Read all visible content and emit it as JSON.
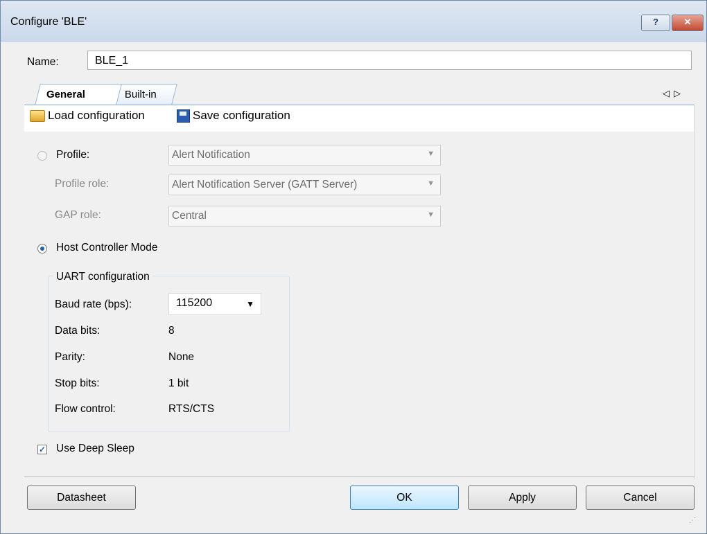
{
  "window": {
    "title": "Configure 'BLE'",
    "help_label": "?",
    "close_label": "✕"
  },
  "name_field": {
    "label": "Name:",
    "value": "BLE_1"
  },
  "tabs": [
    {
      "label": "General"
    },
    {
      "label": "Built-in"
    }
  ],
  "tab_scroll": {
    "left": "◁",
    "right": "▷"
  },
  "toolbar": {
    "load_label": "Load configuration",
    "save_label": "Save configuration",
    "load_icon": "folder-open-icon",
    "save_icon": "floppy-disk-icon"
  },
  "profile": {
    "radio_label": "Profile:",
    "profile_value": "Alert Notification",
    "role_label": "Profile role:",
    "role_value": "Alert Notification Server (GATT Server)",
    "gap_label": "GAP role:",
    "gap_value": "Central"
  },
  "host": {
    "radio_label": "Host Controller Mode"
  },
  "uart": {
    "title": "UART configuration",
    "rows": [
      {
        "label": "Baud rate (bps):",
        "value": "115200"
      },
      {
        "label": "Data bits:",
        "value": "8"
      },
      {
        "label": "Parity:",
        "value": "None"
      },
      {
        "label": "Stop bits:",
        "value": "1 bit"
      },
      {
        "label": "Flow control:",
        "value": "RTS/CTS"
      }
    ]
  },
  "deep_sleep": {
    "label": "Use Deep Sleep",
    "checked": true
  },
  "buttons": {
    "datasheet": "Datasheet",
    "ok": "OK",
    "apply": "Apply",
    "cancel": "Cancel"
  },
  "colors": {
    "title_bar": "#c9d8ea",
    "close": "#c14a33",
    "tab_line": "#7ea5d6",
    "radio_dot": "#235fb0"
  }
}
